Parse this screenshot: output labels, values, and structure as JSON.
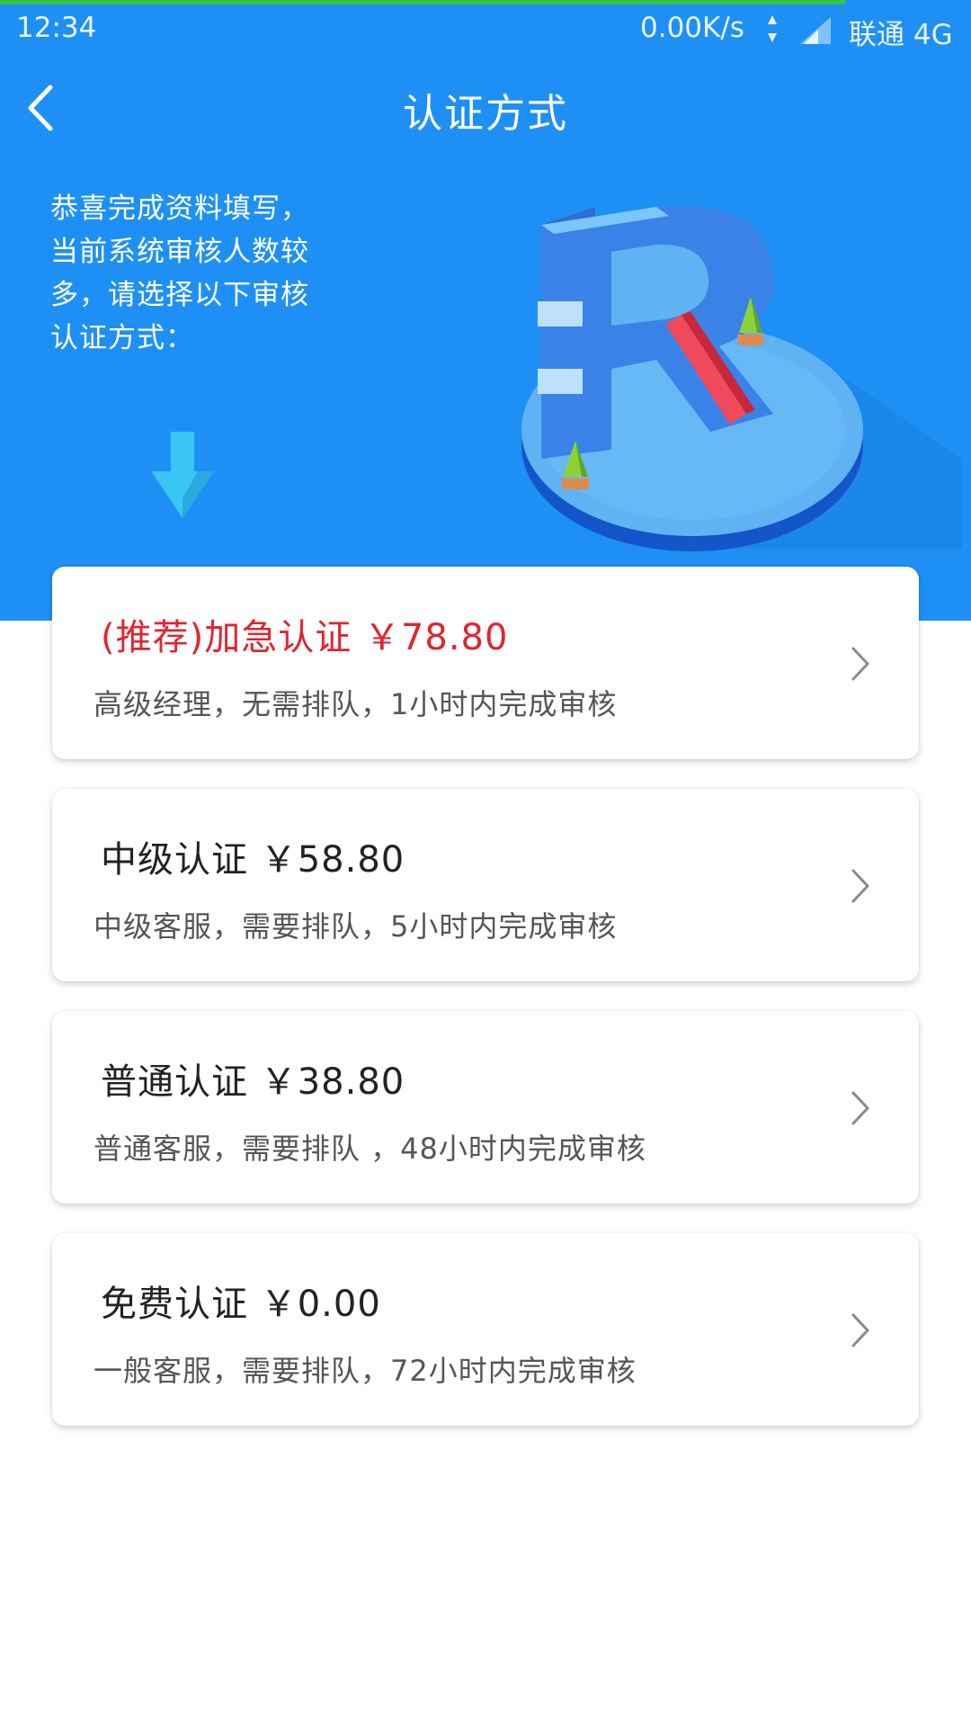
{
  "status_bar": {
    "time": "12:34",
    "net_speed": "0.00K/s",
    "carrier": "联通 4G",
    "icons": [
      "data-arrows-icon",
      "signal-icon"
    ]
  },
  "header": {
    "title": "认证方式",
    "back_icon": "chevron-left-icon"
  },
  "intro": {
    "text": "恭喜完成资料填写，当前系统审核人数较多，请选择以下审核认证方式："
  },
  "options": [
    {
      "title": "(推荐)加急认证 ￥78.80",
      "description": "高级经理，无需排队，1小时内完成审核",
      "highlight": true
    },
    {
      "title": "中级认证 ￥58.80",
      "description": "中级客服，需要排队，5小时内完成审核",
      "highlight": false
    },
    {
      "title": "普通认证 ￥38.80",
      "description": "普通客服，需要排队 ，48小时内完成审核",
      "highlight": false
    },
    {
      "title": "免费认证 ￥0.00",
      "description": "一般客服，需要排队，72小时内完成审核",
      "highlight": false
    }
  ],
  "colors": {
    "primary_blue": "#1e90f5",
    "highlight_red": "#e02430",
    "progress_green": "#36c24a"
  }
}
